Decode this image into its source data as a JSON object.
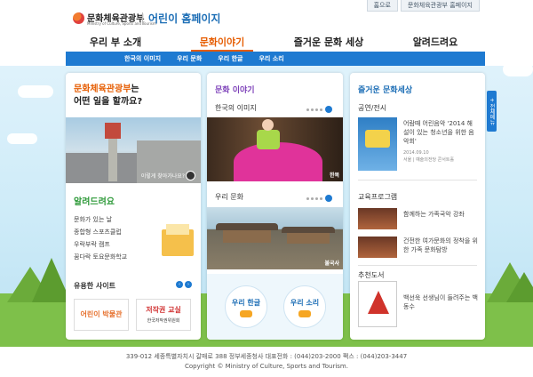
{
  "header": {
    "logo_ko": "문화체육관광부",
    "logo_en": "Ministry of Culture, Sports and Tourism",
    "site_title": "어린이 홈페이지",
    "top_links": [
      "홈으로",
      "문화체육관광부 홈페이지"
    ],
    "gnb": [
      "우리 부 소개",
      "문화이야기",
      "즐거운 문화 세상",
      "알려드려요"
    ],
    "gnb_active": "문화이야기",
    "subnav": [
      "한국의 이미지",
      "우리 문화",
      "우리 한글",
      "우리 소리"
    ]
  },
  "side_tab": "+ 전체메뉴",
  "panel_intro": {
    "title_org": "문화체육관광부",
    "title_suffix": "는",
    "title_line2": "어떤 일을 할까요?",
    "photo_caption": "이렇게 찾아가나요?",
    "notice_title": "알려드려요",
    "notice_items": [
      "문화가 있는 날",
      "종합형 스포츠클럽",
      "우락부락 캠프",
      "꿈다락 토요문화학교"
    ],
    "sites_title": "유용한 사이트",
    "site_nav": [
      "‹",
      "›"
    ],
    "banner1": "어린이 박물관",
    "banner2_title": "저작권 교실",
    "banner2_org": "한국저작권위원회"
  },
  "panel_story": {
    "title": "문화 이야기",
    "sub1": "한국의 이미지",
    "img1_label": "한복",
    "sub2": "우리 문화",
    "img2_label": "불국사",
    "circle1": "우리 한글",
    "circle2": "우리 소리"
  },
  "panel_world": {
    "title": "즐거운 문화세상",
    "sub1": "공연/전시",
    "event_title": "어람때 어린음악 '2014 해설이 있는 청소년을 위한 음악회'",
    "event_date": "2014.09.10",
    "event_place": "서울 | 예술의전당 콘서트홀",
    "sub2": "교육프로그램",
    "edu1": "함께하는 가족국악 강좌",
    "edu2": "건전한 여가문화의 정착을 위한 가족 문화탐방",
    "sub3": "추천도서",
    "book_desc": "백선욱 선생님이 들려주는 백동수"
  },
  "footer": {
    "address": "339-012 세종특별자치시 갈매로 388 정부세종청사 대표전화 : (044)203-2000 팩스 : (044)203-3447",
    "copyright": "Copyright © Ministry of Culture, Sports and Tourism."
  },
  "colors": {
    "accent_blue": "#1e7ad1",
    "accent_orange": "#e65c00",
    "accent_green": "#2f9a3a",
    "accent_purple": "#7c3fb8"
  }
}
